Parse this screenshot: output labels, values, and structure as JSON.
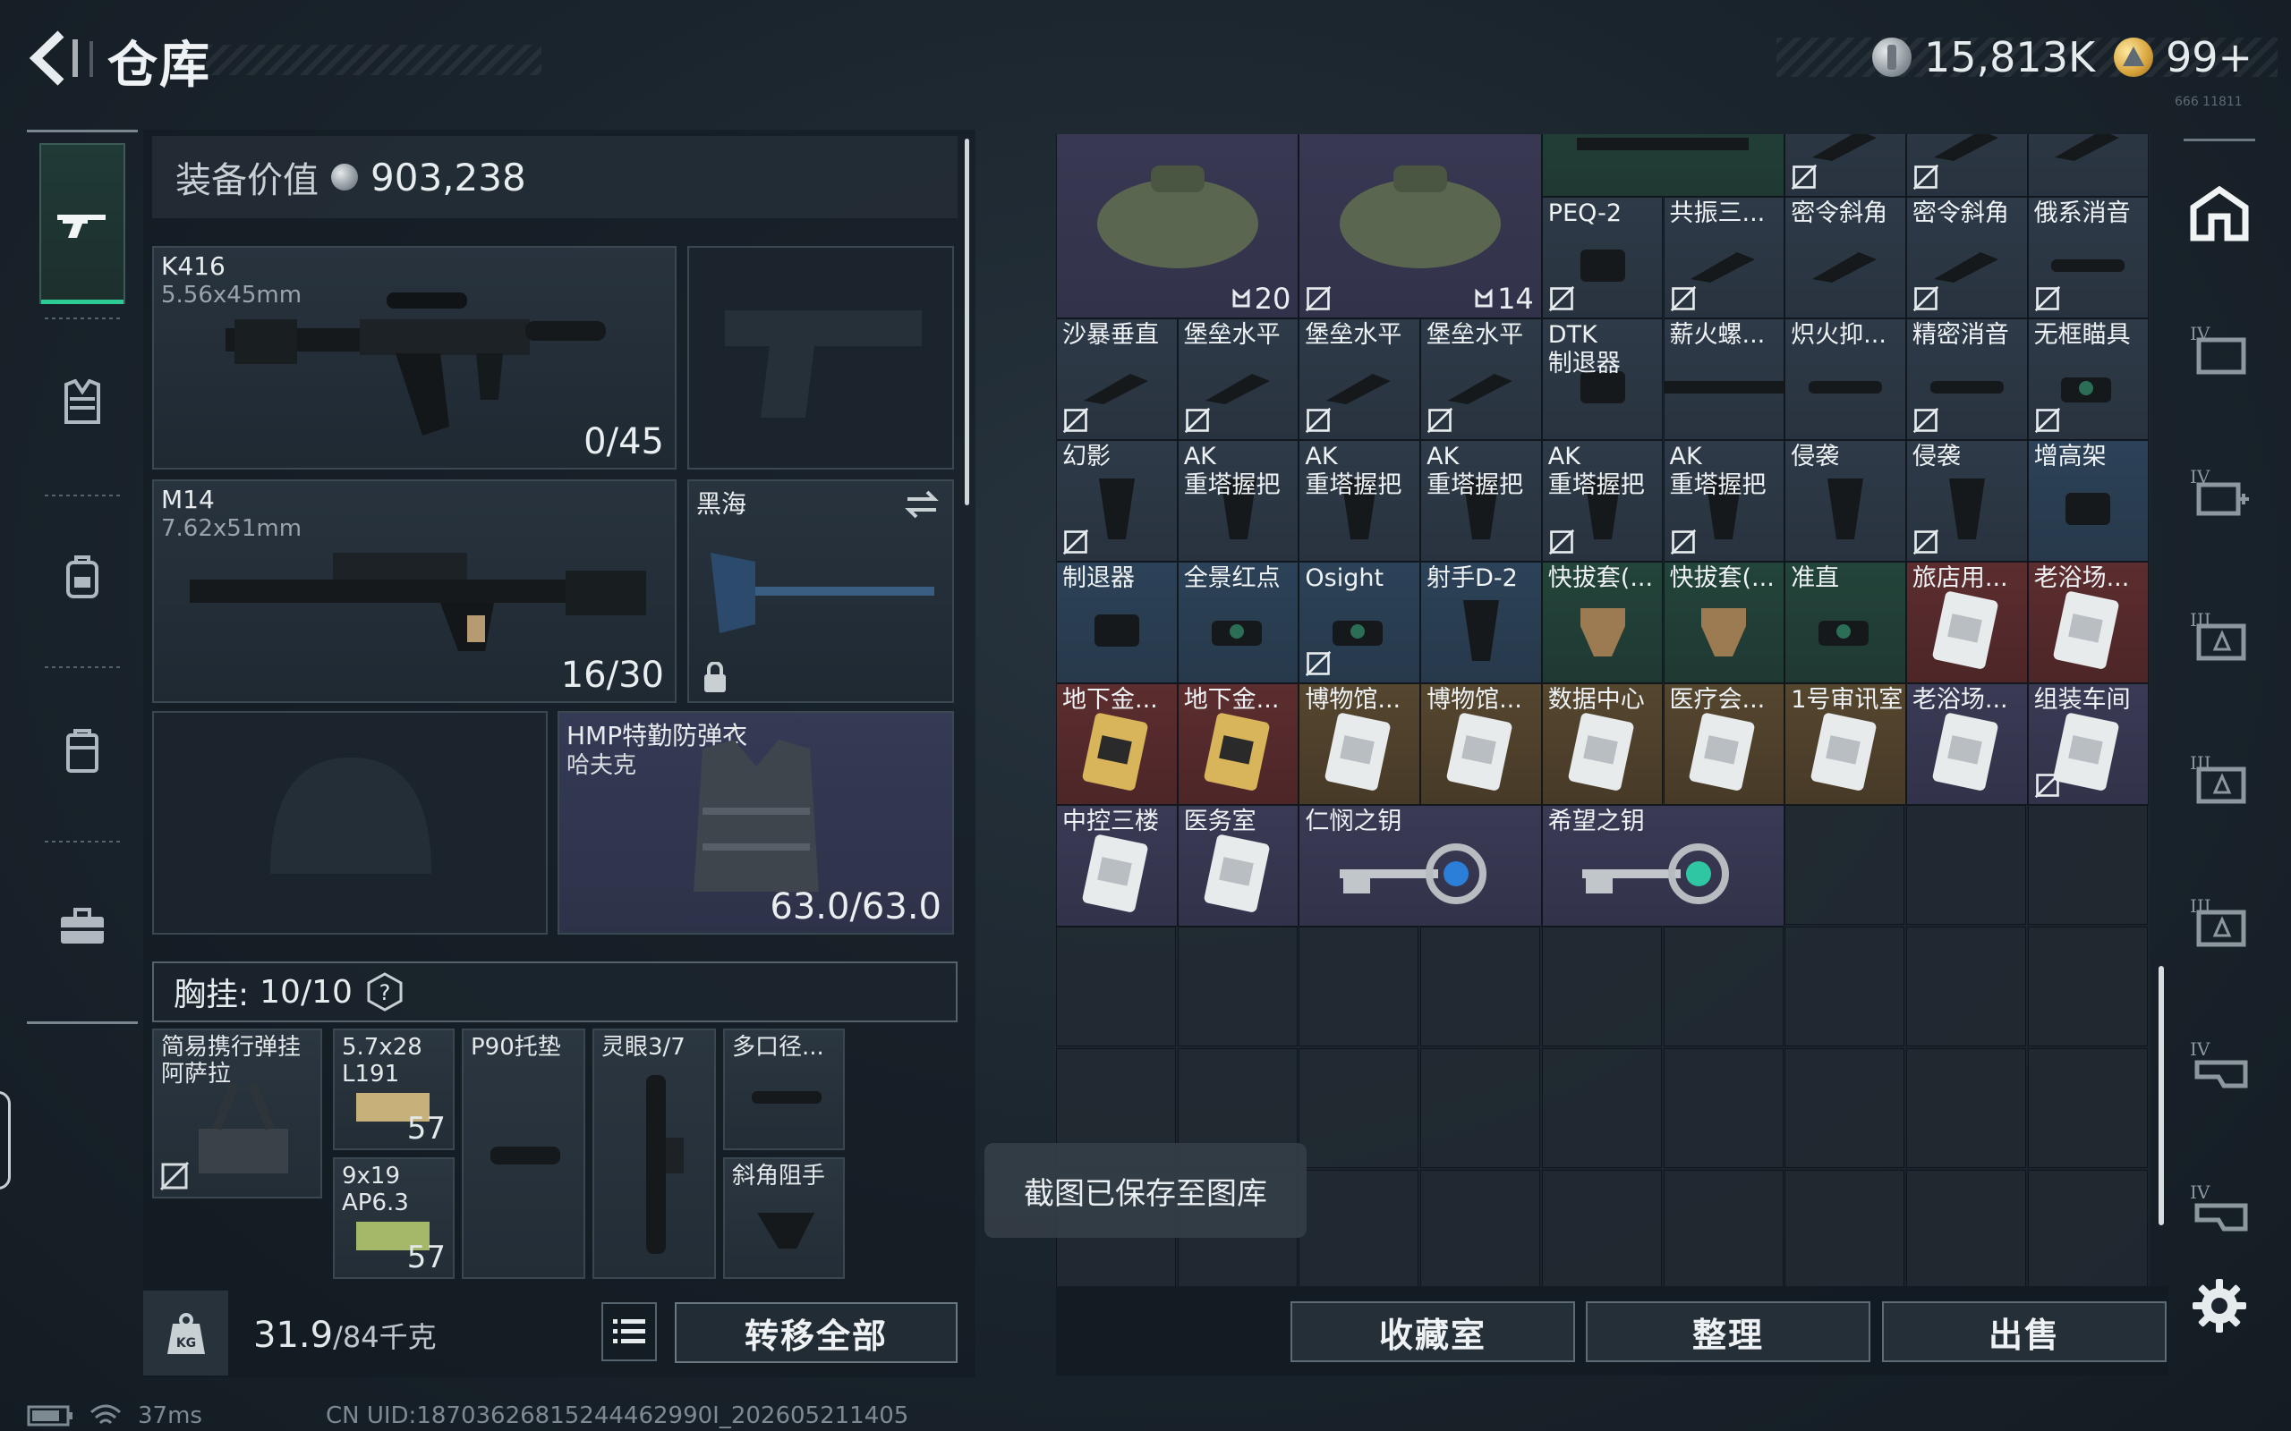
{
  "header": {
    "title": "仓库",
    "currency_silver": "15,813K",
    "currency_gold": "99+",
    "version_text": "666 11811"
  },
  "nav": {
    "items": [
      "rifle-icon",
      "vest-icon",
      "backpack-icon",
      "case-icon",
      "toolbox-icon"
    ]
  },
  "equipment": {
    "value_label": "装备价值",
    "value": "903,238",
    "primary": {
      "name": "K416",
      "caliber": "5.56x45mm",
      "ammo": "0/45"
    },
    "secondary": {
      "name": "M14",
      "caliber": "7.62x51mm",
      "ammo": "16/30"
    },
    "melee": {
      "name": "黑海"
    },
    "armor": {
      "name": "HMP特勤防弹衣",
      "sub": "哈夫克",
      "durability": "63.0/63.0"
    },
    "chest_label": "胸挂:",
    "chest_capacity": "10/10",
    "chest_rig": {
      "name": "简易携行弹挂",
      "sub": "阿萨拉"
    },
    "chest_items": [
      {
        "name": "5.7x28",
        "sub": "L191",
        "count": "57"
      },
      {
        "name": "9x19",
        "sub": "AP6.3",
        "count": "57"
      },
      {
        "name": "P90托垫"
      },
      {
        "name": "灵眼3/7"
      },
      {
        "name": "多口径..."
      },
      {
        "name": "斜角阻手"
      }
    ],
    "weight": "31.9",
    "weight_max": "/84千克",
    "weight_icon_text": "KG",
    "transfer_all": "转移全部"
  },
  "status": {
    "ping": "37ms",
    "uid": "CN UID:18703626815244462990I_202605211405"
  },
  "storage": {
    "items": [
      {
        "label": "",
        "num": "20",
        "rarity": "purple",
        "icon": "bag-icon",
        "row": 0,
        "col": 0,
        "w": 2,
        "h": 2,
        "bind": false
      },
      {
        "label": "",
        "num": "14",
        "rarity": "purple",
        "icon": "bag-icon",
        "row": 0,
        "col": 2,
        "w": 2,
        "h": 2,
        "bind": true
      },
      {
        "label": "",
        "rarity": "green",
        "icon": "rail-icon",
        "row": 0,
        "col": 4,
        "w": 2,
        "h": 1,
        "bind": false
      },
      {
        "label": "",
        "rarity": "default",
        "icon": "part-icon",
        "row": 0,
        "col": 6,
        "w": 1,
        "h": 1,
        "bind": true
      },
      {
        "label": "",
        "rarity": "default",
        "icon": "part-icon",
        "row": 0,
        "col": 7,
        "w": 1,
        "h": 1,
        "bind": true
      },
      {
        "label": "",
        "rarity": "default",
        "icon": "part-icon",
        "row": 0,
        "col": 8,
        "w": 1,
        "h": 1,
        "bind": false
      },
      {
        "label": "PEQ-2",
        "rarity": "default",
        "icon": "laser-icon",
        "row": 1,
        "col": 4,
        "w": 1,
        "h": 1,
        "bind": true
      },
      {
        "label": "共振三...",
        "rarity": "default",
        "icon": "grip-icon",
        "row": 1,
        "col": 5,
        "w": 1,
        "h": 1,
        "bind": true
      },
      {
        "label": "密令斜角",
        "rarity": "default",
        "icon": "grip-icon",
        "row": 1,
        "col": 6,
        "w": 1,
        "h": 1,
        "bind": false
      },
      {
        "label": "密令斜角",
        "rarity": "default",
        "icon": "grip-icon",
        "row": 1,
        "col": 7,
        "w": 1,
        "h": 1,
        "bind": true
      },
      {
        "label": "俄系消音",
        "rarity": "default",
        "icon": "suppressor-icon",
        "row": 1,
        "col": 8,
        "w": 1,
        "h": 1,
        "bind": true
      },
      {
        "label": "沙暴垂直",
        "rarity": "default",
        "icon": "grip-icon",
        "row": 2,
        "col": 0,
        "w": 1,
        "h": 1,
        "bind": true
      },
      {
        "label": "堡垒水平",
        "rarity": "default",
        "icon": "grip-icon",
        "row": 2,
        "col": 1,
        "w": 1,
        "h": 1,
        "bind": true
      },
      {
        "label": "堡垒水平",
        "rarity": "default",
        "icon": "grip-icon",
        "row": 2,
        "col": 2,
        "w": 1,
        "h": 1,
        "bind": true
      },
      {
        "label": "堡垒水平",
        "rarity": "default",
        "icon": "grip-icon",
        "row": 2,
        "col": 3,
        "w": 1,
        "h": 1,
        "bind": true
      },
      {
        "label": "DTK\n制退器",
        "rarity": "default",
        "icon": "brake-icon",
        "row": 2,
        "col": 4,
        "w": 1,
        "h": 1,
        "bind": false
      },
      {
        "label": "薪火螺...",
        "rarity": "default",
        "icon": "rail-icon",
        "row": 2,
        "col": 5,
        "w": 1,
        "h": 1,
        "bind": false
      },
      {
        "label": "炽火抑...",
        "rarity": "default",
        "icon": "suppressor-icon",
        "row": 2,
        "col": 6,
        "w": 1,
        "h": 1,
        "bind": false
      },
      {
        "label": "精密消音",
        "rarity": "default",
        "icon": "suppressor-icon",
        "row": 2,
        "col": 7,
        "w": 1,
        "h": 1,
        "bind": true
      },
      {
        "label": "无框瞄具",
        "rarity": "default",
        "icon": "sight-icon",
        "row": 2,
        "col": 8,
        "w": 1,
        "h": 1,
        "bind": true
      },
      {
        "label": "幻影",
        "rarity": "default",
        "icon": "pistol-grip-icon",
        "row": 3,
        "col": 0,
        "w": 1,
        "h": 1,
        "bind": true
      },
      {
        "label": "AK\n重塔握把",
        "rarity": "default",
        "icon": "pistol-grip-icon",
        "row": 3,
        "col": 1,
        "w": 1,
        "h": 1,
        "bind": false
      },
      {
        "label": "AK\n重塔握把",
        "rarity": "default",
        "icon": "pistol-grip-icon",
        "row": 3,
        "col": 2,
        "w": 1,
        "h": 1,
        "bind": false
      },
      {
        "label": "AK\n重塔握把",
        "rarity": "default",
        "icon": "pistol-grip-icon",
        "row": 3,
        "col": 3,
        "w": 1,
        "h": 1,
        "bind": false
      },
      {
        "label": "AK\n重塔握把",
        "rarity": "default",
        "icon": "pistol-grip-icon",
        "row": 3,
        "col": 4,
        "w": 1,
        "h": 1,
        "bind": true
      },
      {
        "label": "AK\n重塔握把",
        "rarity": "default",
        "icon": "pistol-grip-icon",
        "row": 3,
        "col": 5,
        "w": 1,
        "h": 1,
        "bind": true
      },
      {
        "label": "侵袭",
        "rarity": "default",
        "icon": "pistol-grip-icon",
        "row": 3,
        "col": 6,
        "w": 1,
        "h": 1,
        "bind": false
      },
      {
        "label": "侵袭",
        "rarity": "default",
        "icon": "pistol-grip-icon",
        "row": 3,
        "col": 7,
        "w": 1,
        "h": 1,
        "bind": true
      },
      {
        "label": "增高架",
        "rarity": "blue",
        "icon": "mount-icon",
        "row": 3,
        "col": 8,
        "w": 1,
        "h": 1,
        "bind": false
      },
      {
        "label": "制退器",
        "rarity": "blue",
        "icon": "brake-icon",
        "row": 4,
        "col": 0,
        "w": 1,
        "h": 1,
        "bind": false
      },
      {
        "label": "全景红点",
        "rarity": "blue",
        "icon": "sight-icon",
        "row": 4,
        "col": 1,
        "w": 1,
        "h": 1,
        "bind": false
      },
      {
        "label": "Osight",
        "rarity": "blue",
        "icon": "sight-icon",
        "row": 4,
        "col": 2,
        "w": 1,
        "h": 1,
        "bind": true
      },
      {
        "label": "射手D-2",
        "rarity": "blue",
        "icon": "pistol-grip-icon",
        "row": 4,
        "col": 3,
        "w": 1,
        "h": 1,
        "bind": false
      },
      {
        "label": "快拔套(...",
        "rarity": "green",
        "icon": "holster-icon",
        "row": 4,
        "col": 4,
        "w": 1,
        "h": 1,
        "bind": false
      },
      {
        "label": "快拔套(...",
        "rarity": "green",
        "icon": "holster-icon",
        "row": 4,
        "col": 5,
        "w": 1,
        "h": 1,
        "bind": false
      },
      {
        "label": "准直",
        "rarity": "green",
        "icon": "sight-icon",
        "row": 4,
        "col": 6,
        "w": 1,
        "h": 1,
        "bind": false
      },
      {
        "label": "旅店用...",
        "rarity": "red",
        "icon": "keycard-icon",
        "row": 4,
        "col": 7,
        "w": 1,
        "h": 1,
        "bind": false
      },
      {
        "label": "老浴场...",
        "rarity": "red",
        "icon": "keycard-icon",
        "row": 4,
        "col": 8,
        "w": 1,
        "h": 1,
        "bind": false
      },
      {
        "label": "地下金...",
        "rarity": "red",
        "icon": "keycard-gold-icon",
        "row": 5,
        "col": 0,
        "w": 1,
        "h": 1,
        "bind": false
      },
      {
        "label": "地下金...",
        "rarity": "red",
        "icon": "keycard-gold-icon",
        "row": 5,
        "col": 1,
        "w": 1,
        "h": 1,
        "bind": false
      },
      {
        "label": "博物馆...",
        "rarity": "gold",
        "icon": "keycard-icon",
        "row": 5,
        "col": 2,
        "w": 1,
        "h": 1,
        "bind": false
      },
      {
        "label": "博物馆...",
        "rarity": "gold",
        "icon": "keycard-icon",
        "row": 5,
        "col": 3,
        "w": 1,
        "h": 1,
        "bind": false
      },
      {
        "label": "数据中心",
        "rarity": "gold",
        "icon": "keycard-icon",
        "row": 5,
        "col": 4,
        "w": 1,
        "h": 1,
        "bind": false
      },
      {
        "label": "医疗会...",
        "rarity": "gold",
        "icon": "keycard-icon",
        "row": 5,
        "col": 5,
        "w": 1,
        "h": 1,
        "bind": false
      },
      {
        "label": "1号审讯室",
        "rarity": "gold",
        "icon": "keycard-icon",
        "row": 5,
        "col": 6,
        "w": 1,
        "h": 1,
        "bind": false
      },
      {
        "label": "老浴场...",
        "rarity": "purple",
        "icon": "keycard-icon",
        "row": 5,
        "col": 7,
        "w": 1,
        "h": 1,
        "bind": false
      },
      {
        "label": "组装车间",
        "rarity": "purple",
        "icon": "keycard-icon",
        "row": 5,
        "col": 8,
        "w": 1,
        "h": 1,
        "bind": true
      },
      {
        "label": "中控三楼",
        "rarity": "purple",
        "icon": "keycard-icon",
        "row": 6,
        "col": 0,
        "w": 1,
        "h": 1,
        "bind": false
      },
      {
        "label": "医务室",
        "rarity": "purple",
        "icon": "keycard-icon",
        "row": 6,
        "col": 1,
        "w": 1,
        "h": 1,
        "bind": false
      },
      {
        "label": "仁悯之钥",
        "rarity": "purple",
        "icon": "key-blue-icon",
        "row": 6,
        "col": 2,
        "w": 2,
        "h": 1,
        "bind": false
      },
      {
        "label": "希望之钥",
        "rarity": "purple",
        "icon": "key-teal-icon",
        "row": 6,
        "col": 4,
        "w": 2,
        "h": 1,
        "bind": false
      }
    ]
  },
  "actions": {
    "collection": "收藏室",
    "sort": "整理",
    "sell": "出售"
  },
  "rail": {
    "icons": [
      "storage-home-icon",
      "folder-iv-icon",
      "add-iv-icon",
      "box-iii-icon",
      "box-iii-icon",
      "box-iii-icon",
      "box-iv-icon",
      "box-iv-icon",
      "settings-icon"
    ]
  },
  "toast": "截图已保存至图库",
  "colors": {
    "accent_green": "#2ecc95",
    "rarity_purple": "#3a3a55",
    "rarity_blue": "#2c4258",
    "rarity_green": "#23443a",
    "rarity_gold": "#55462f",
    "rarity_red": "#5c2d2f"
  }
}
